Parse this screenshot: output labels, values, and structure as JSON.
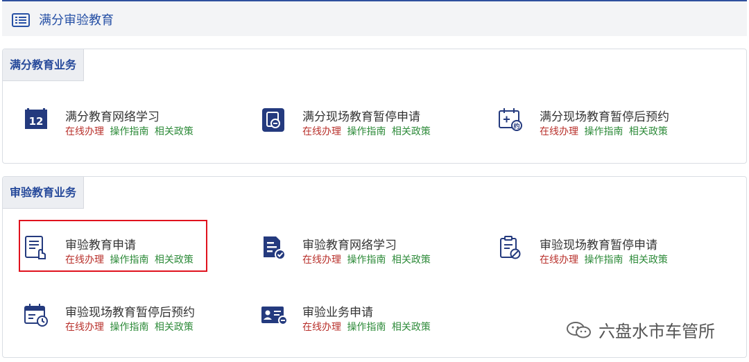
{
  "header": {
    "title": "满分审验教育"
  },
  "sections": [
    {
      "title": "满分教育业务",
      "items": [
        {
          "name": "满分教育网络学习",
          "icon": "network-study-icon"
        },
        {
          "name": "满分现场教育暂停申请",
          "icon": "pause-request-icon"
        },
        {
          "name": "满分现场教育暂停后预约",
          "icon": "calendar-appointment-icon"
        }
      ]
    },
    {
      "title": "审验教育业务",
      "items": [
        {
          "name": "审验教育申请",
          "icon": "document-hand-icon"
        },
        {
          "name": "审验教育网络学习",
          "icon": "document-check-icon"
        },
        {
          "name": "审验现场教育暂停申请",
          "icon": "clipboard-pause-icon"
        },
        {
          "name": "审验现场教育暂停后预约",
          "icon": "calendar-clock-icon"
        },
        {
          "name": "审验业务申请",
          "icon": "id-card-icon"
        }
      ]
    }
  ],
  "links": {
    "online": "在线办理",
    "guide": "操作指南",
    "policy": "相关政策"
  },
  "watermark": {
    "text": "六盘水市车管所"
  },
  "colors": {
    "primary": "#2650a5",
    "online": "#b8302b",
    "guide": "#2e8b3a",
    "highlight": "#e0121d"
  }
}
